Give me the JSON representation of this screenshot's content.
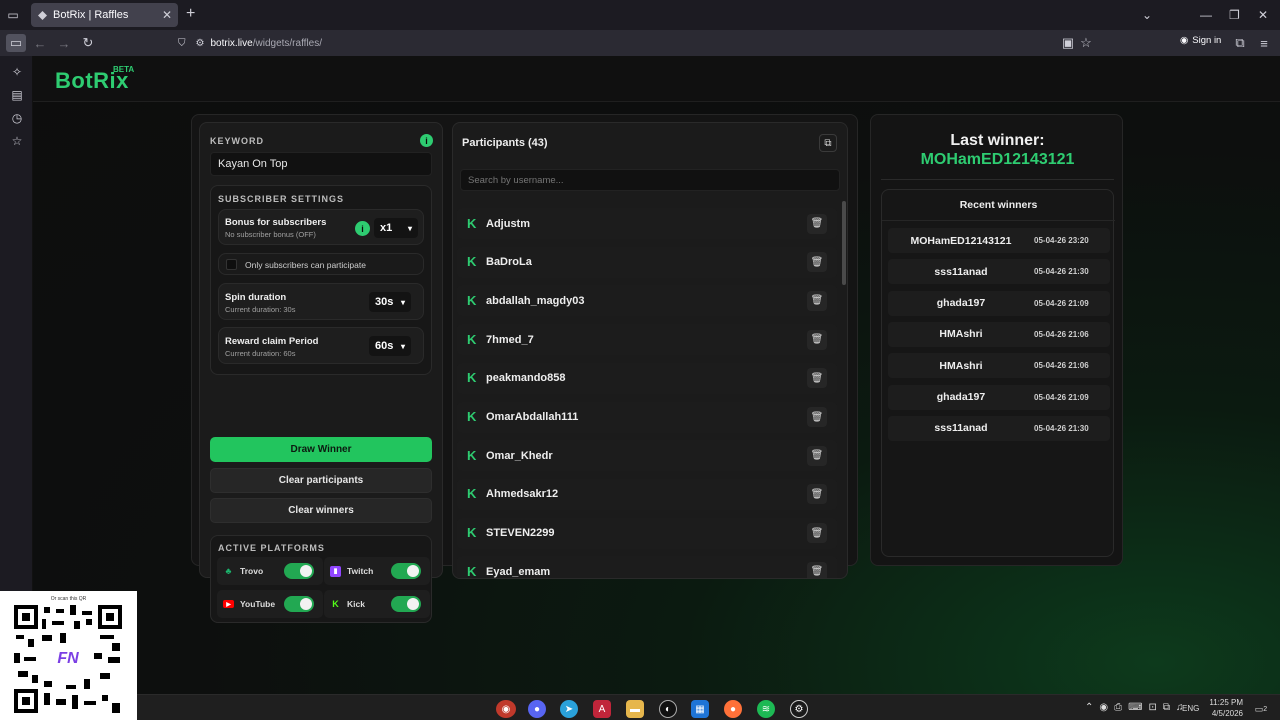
{
  "browser": {
    "tab_title": "BotRix | Raffles",
    "url_host": "botrix.live",
    "url_path": "/widgets/raffles/",
    "sign_in": "Sign in"
  },
  "brand": {
    "name": "BotRix",
    "badge": "BETA",
    "accent": "#2ecc71"
  },
  "settings": {
    "keyword_label": "KEYWORD",
    "keyword_value": "Kayan On Top",
    "subscriber_settings_label": "SUBSCRIBER SETTINGS",
    "bonus_title": "Bonus for subscribers",
    "bonus_sub": "No subscriber bonus (OFF)",
    "bonus_value": "x1",
    "only_subs_label": "Only subscribers can participate",
    "spin_title": "Spin duration",
    "spin_sub": "Current duration: 30s",
    "spin_value": "30s",
    "reward_title": "Reward claim Period",
    "reward_sub": "Current duration: 60s",
    "reward_value": "60s",
    "draw_button": "Draw Winner",
    "clear_participants_button": "Clear participants",
    "clear_winners_button": "Clear winners",
    "platforms_label": "ACTIVE PLATFORMS",
    "platforms": [
      {
        "name": "Trovo",
        "enabled": true,
        "icon": "trovo-icon",
        "color": "#1bb76e"
      },
      {
        "name": "Twitch",
        "enabled": true,
        "icon": "twitch-icon",
        "color": "#9146ff"
      },
      {
        "name": "YouTube",
        "enabled": true,
        "icon": "youtube-icon",
        "color": "#ff0000"
      },
      {
        "name": "Kick",
        "enabled": true,
        "icon": "kick-icon",
        "color": "#53fc18"
      }
    ]
  },
  "participants": {
    "title": "Participants (43)",
    "search_placeholder": "Search by username...",
    "list": [
      "Adjustm",
      "BaDroLa",
      "abdallah_magdy03",
      "7hmed_7",
      "peakmando858",
      "OmarAbdallah111",
      "Omar_Khedr",
      "Ahmedsakr12",
      "STEVEN2299",
      "Eyad_emam"
    ]
  },
  "winners": {
    "last_label": "Last winner:",
    "last_name": "MOHamED12143121",
    "recent_label": "Recent winners",
    "list": [
      {
        "name": "MOHamED12143121",
        "date": "05-04-26 23:20"
      },
      {
        "name": "sss11anad",
        "date": "05-04-26 21:30"
      },
      {
        "name": "ghada197",
        "date": "05-04-26 21:09"
      },
      {
        "name": "HMAshri",
        "date": "05-04-26 21:06"
      },
      {
        "name": "HMAshri",
        "date": "05-04-26 21:06"
      },
      {
        "name": "ghada197",
        "date": "05-04-26 21:09"
      },
      {
        "name": "sss11anad",
        "date": "05-04-26 21:30"
      }
    ]
  },
  "qr": {
    "caption": "Or scan this QR"
  },
  "taskbar": {
    "time": "11:25 PM",
    "date": "4/5/2026",
    "lang": "ENG",
    "notif": "2"
  }
}
